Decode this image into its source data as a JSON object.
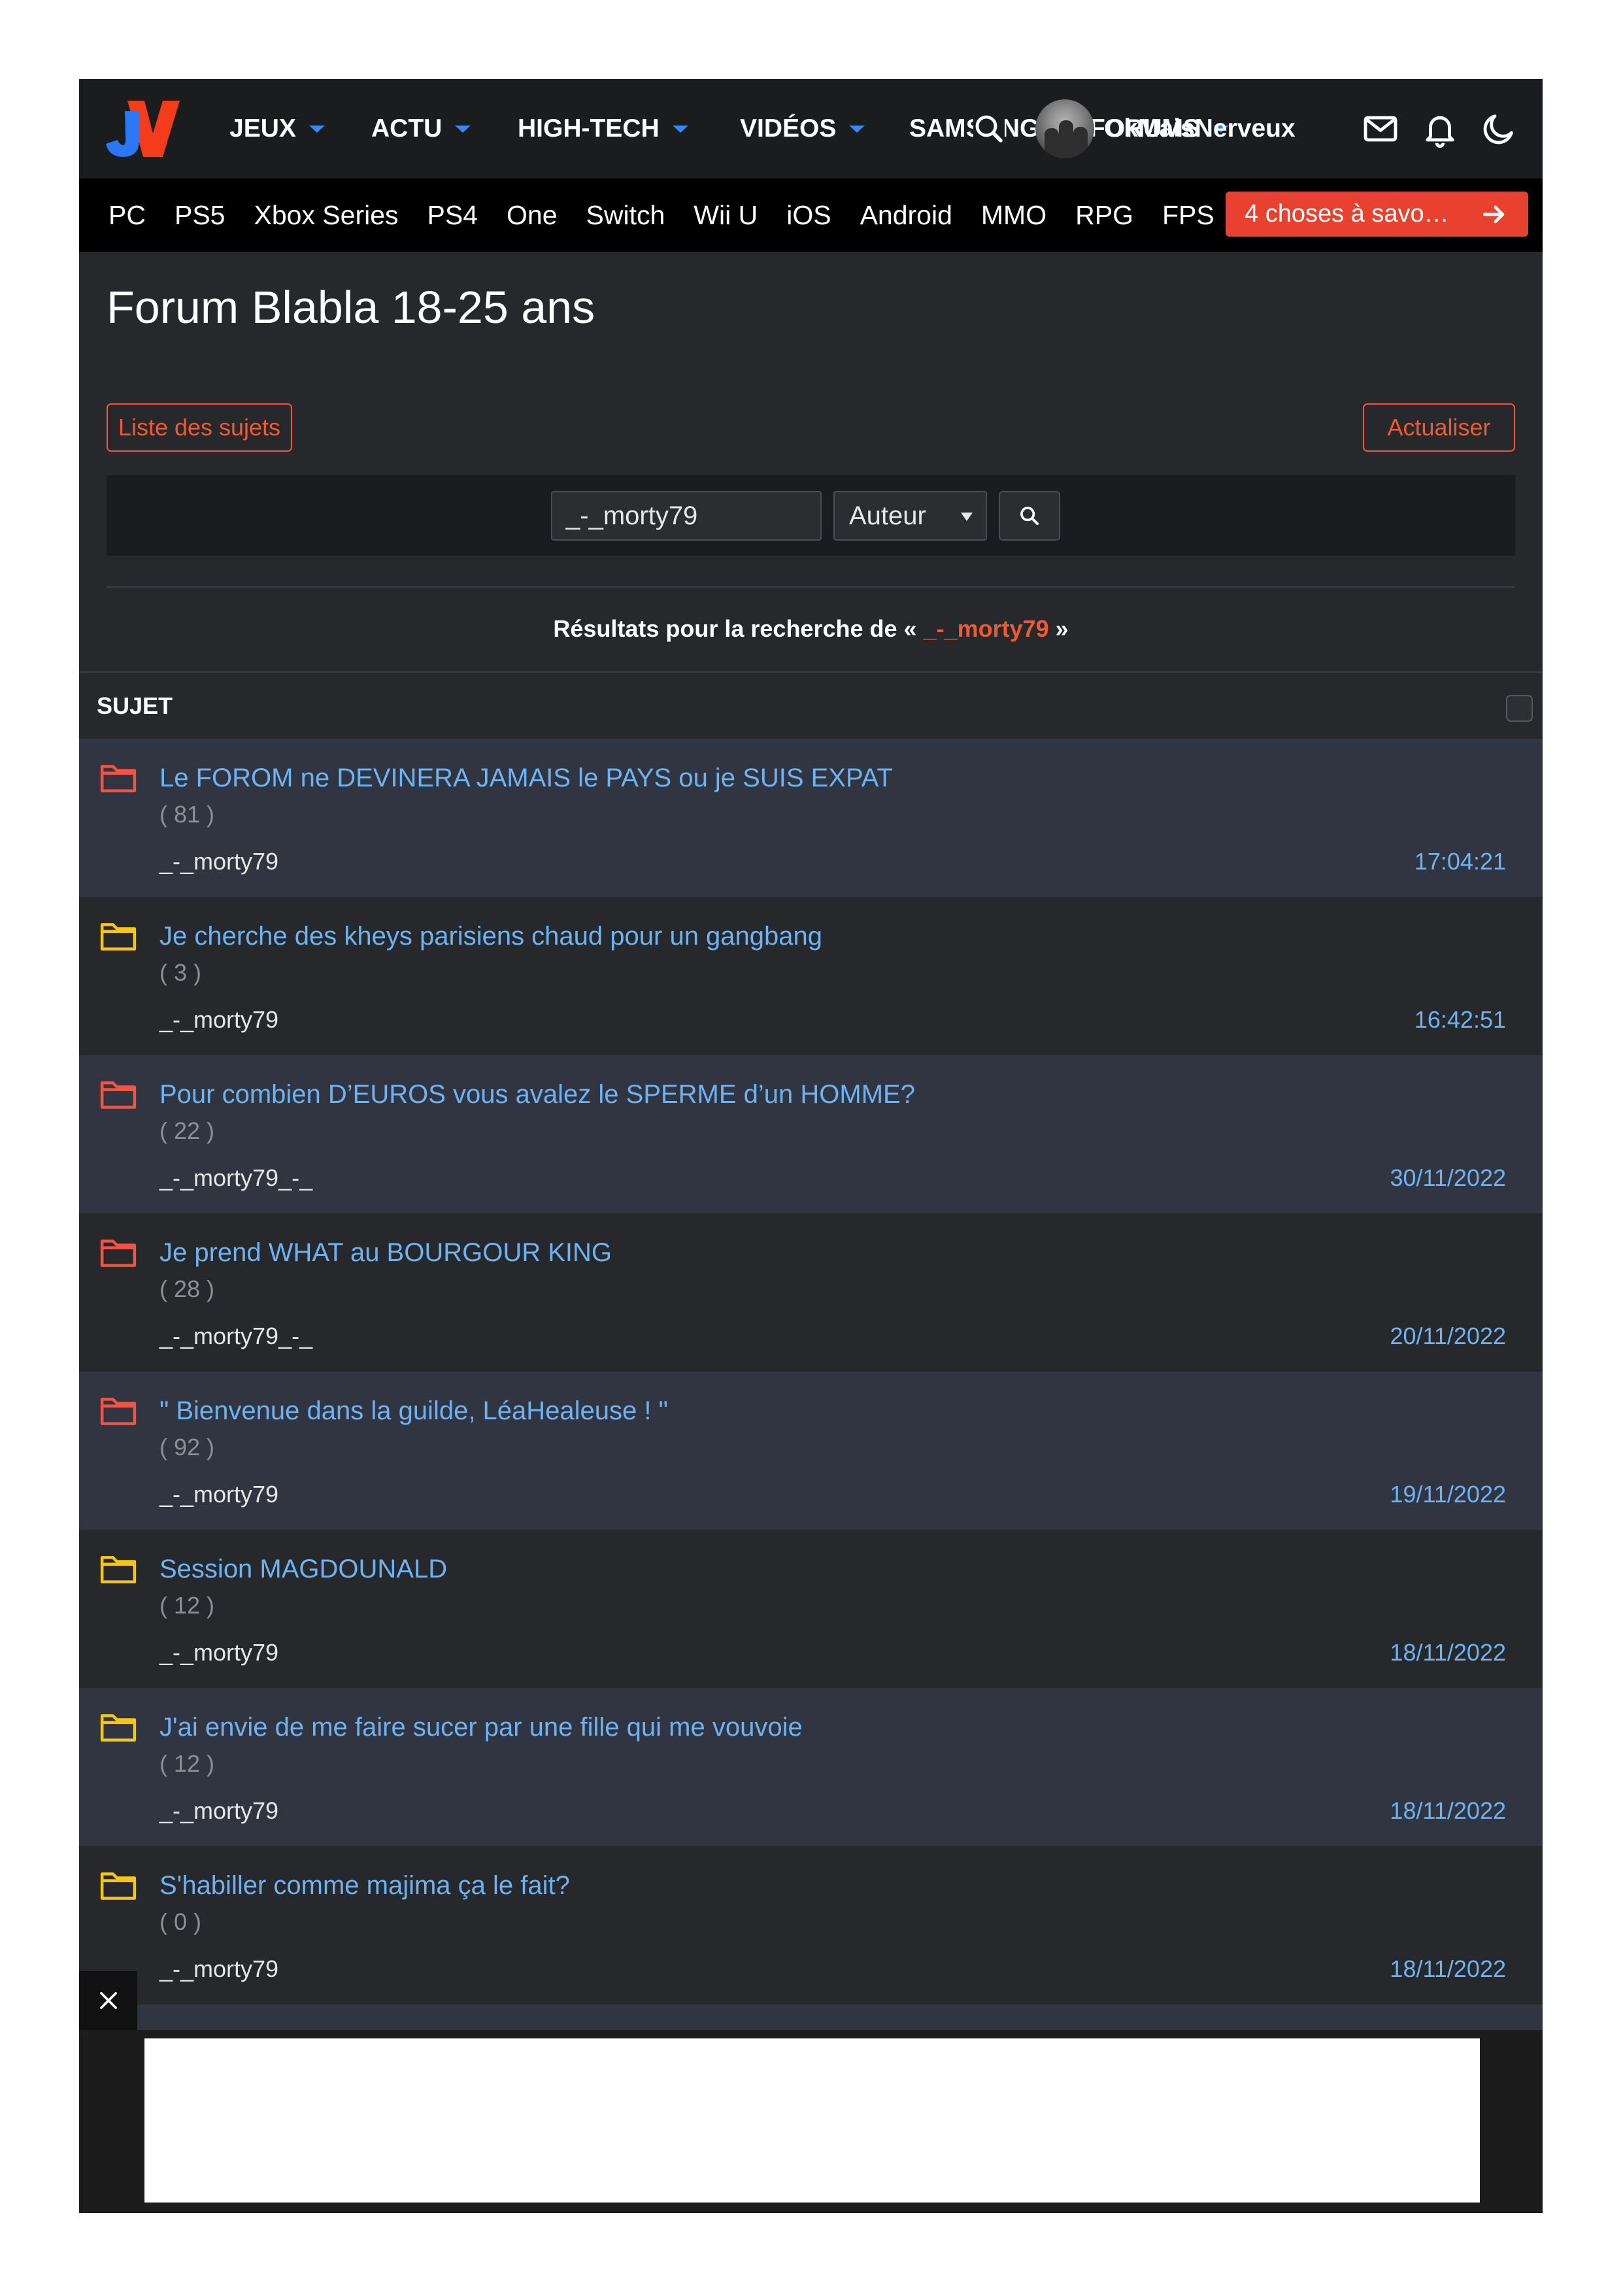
{
  "colors": {
    "accent": "#ef5a33",
    "link": "#6db3f2",
    "promo": "#e8412f",
    "nav_caret": "#3b87f3"
  },
  "logo": {
    "text": "JV"
  },
  "topnav": {
    "items": [
      {
        "label": "JEUX"
      },
      {
        "label": "ACTU"
      },
      {
        "label": "HIGH-TECH"
      },
      {
        "label": "VIDÉOS"
      },
      {
        "label": "SAMSUNG"
      },
      {
        "label": "FORUMS"
      }
    ],
    "item_icon": "caret-down-icon",
    "search_icon": "search-icon",
    "user": {
      "name": "OkMaisNerveux"
    },
    "action_icons": [
      "mail-icon",
      "bell-icon",
      "moon-icon"
    ]
  },
  "platforms": {
    "items": [
      "PC",
      "PS5",
      "Xbox Series",
      "PS4",
      "One",
      "Switch",
      "Wii U",
      "iOS",
      "Android",
      "MMO",
      "RPG",
      "FPS"
    ],
    "promo": {
      "label": "4 choses à savo…",
      "icon": "arrow-right-icon"
    }
  },
  "forum": {
    "title": "Forum Blabla 18-25 ans",
    "topic_list_button": "Liste des sujets",
    "refresh_button": "Actualiser"
  },
  "search": {
    "value": "_-_morty79",
    "type": "Auteur",
    "button_icon": "search-icon"
  },
  "results": {
    "prefix": "Résultats pour la recherche de « ",
    "query": "_-_morty79",
    "suffix": " »"
  },
  "topics_table": {
    "column": "SUJET",
    "rows": [
      {
        "title": "Le FOROM ne DEVINERA JAMAIS le PAYS ou je SUIS EXPAT",
        "replies": "( 81 )",
        "author": "_-_morty79",
        "date": "17:04:21",
        "folder_icon": "folder-icon",
        "folder_color": "#f05442"
      },
      {
        "title": "Je cherche des kheys parisiens chaud pour un gangbang",
        "replies": "( 3 )",
        "author": "_-_morty79",
        "date": "16:42:51",
        "folder_icon": "folder-icon",
        "folder_color": "#f5c518"
      },
      {
        "title": "Pour combien D’EUROS vous avalez le SPERME d’un HOMME?",
        "replies": "( 22 )",
        "author": "_-_morty79_-_",
        "date": "30/11/2022",
        "folder_icon": "folder-icon",
        "folder_color": "#f05442"
      },
      {
        "title": "Je prend WHAT au BOURGOUR KING",
        "replies": "( 28 )",
        "author": "_-_morty79_-_",
        "date": "20/11/2022",
        "folder_icon": "folder-icon",
        "folder_color": "#f05442"
      },
      {
        "title": "\" Bienvenue dans la guilde, LéaHealeuse ! \"",
        "replies": "( 92 )",
        "author": "_-_morty79",
        "date": "19/11/2022",
        "folder_icon": "folder-icon",
        "folder_color": "#f05442"
      },
      {
        "title": "Session MAGDOUNALD",
        "replies": "( 12 )",
        "author": "_-_morty79",
        "date": "18/11/2022",
        "folder_icon": "folder-icon",
        "folder_color": "#f5c518"
      },
      {
        "title": "J'ai envie de me faire sucer par une fille qui me vouvoie",
        "replies": "( 12 )",
        "author": "_-_morty79",
        "date": "18/11/2022",
        "folder_icon": "folder-icon",
        "folder_color": "#f5c518"
      },
      {
        "title": "S'habiller comme majima ça le fait?",
        "replies": "( 0 )",
        "author": "_-_morty79",
        "date": "18/11/2022",
        "folder_icon": "folder-icon",
        "folder_color": "#f5c518"
      }
    ]
  },
  "ad": {
    "close_icon": "close-icon"
  }
}
